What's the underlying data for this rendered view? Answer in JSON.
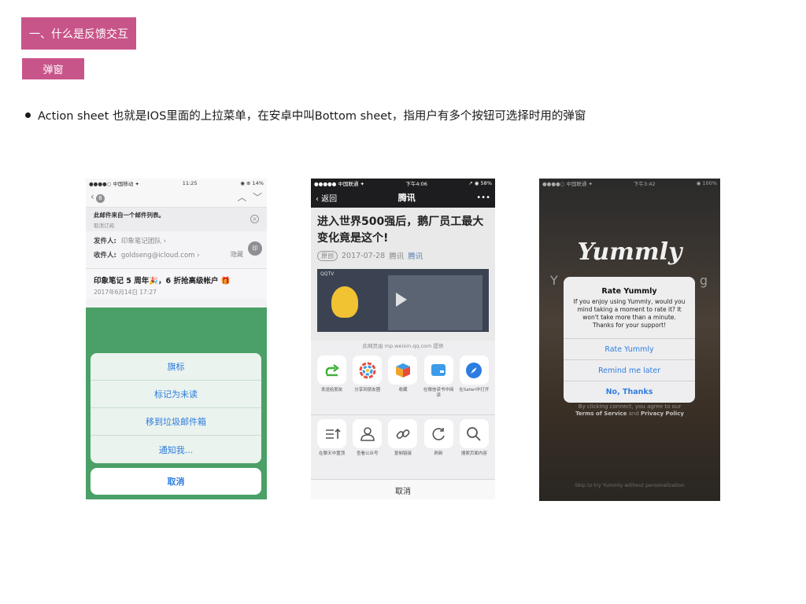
{
  "header": {
    "section_title": "一、什么是反馈交互",
    "subsection": "弹窗"
  },
  "bullet": {
    "text": "Action sheet 也就是IOS里面的上拉菜单，在安卓中叫Bottom sheet，指用户有多个按钮可选择时用的弹窗"
  },
  "colors": {
    "tag_bg": "#c85589",
    "ios_blue": "#2d7ce0"
  },
  "phone1": {
    "status": {
      "carrier": "●●●●○ 中国移动 ✦",
      "time": "11:25",
      "battery": "◉ ⊕ 14%"
    },
    "nav": {
      "back_badge": "8"
    },
    "notice": {
      "line1": "此邮件来自一个邮件列表。",
      "line2": "取消订阅"
    },
    "sender_label": "发件人:",
    "sender_value": "印象笔记团队 ›",
    "recipient_label": "收件人:",
    "recipient_value": "goldseng@icloud.com ›",
    "hide_label": "隐藏",
    "avatar": "印",
    "subject": "印象笔记 5 周年🎉，6 折抢高级帐户 🎁",
    "date": "2017年6月14日 17:27",
    "sheet_options": [
      "旗标",
      "标记为未读",
      "移到垃圾邮件箱",
      "通知我..."
    ],
    "cancel": "取消"
  },
  "phone2": {
    "status": {
      "carrier": "●●●●● 中国联通 ✦",
      "time": "下午4:06",
      "battery": "↗ ◉ 58%"
    },
    "nav": {
      "back": "‹ 返回",
      "title": "腾讯",
      "more": "•••"
    },
    "headline": "进入世界500强后，鹅厂员工最大变化竟是这个!",
    "meta": {
      "original": "原创",
      "date": "2017-07-28",
      "author": "腾讯",
      "account": "腾讯"
    },
    "video_tag": "QQTV",
    "source": "此网页由 mp.weixin.qq.com 提供",
    "row1": [
      {
        "label": "发送给朋友",
        "icon": "share-arrow-icon"
      },
      {
        "label": "分享到朋友圈",
        "icon": "moments-icon"
      },
      {
        "label": "收藏",
        "icon": "favorite-cube-icon"
      },
      {
        "label": "在微信读书中阅读",
        "icon": "wechat-read-icon"
      },
      {
        "label": "在Safari中打开",
        "icon": "safari-compass-icon"
      }
    ],
    "row2": [
      {
        "label": "在聊天中置顶",
        "icon": "pin-top-icon"
      },
      {
        "label": "查看公众号",
        "icon": "profile-icon"
      },
      {
        "label": "复制链接",
        "icon": "link-icon"
      },
      {
        "label": "刷新",
        "icon": "refresh-icon"
      },
      {
        "label": "搜索页面内容",
        "icon": "search-icon"
      }
    ],
    "cancel": "取消"
  },
  "phone3": {
    "status": {
      "carrier": "●●●●○ 中国联通 ✦",
      "time": "下午3:42",
      "battery": "◉ 100%"
    },
    "logo": "Yummly",
    "ghost_left": "Y",
    "ghost_right": "g",
    "alert": {
      "title": "Rate Yummly",
      "message": "If you enjoy using Yummly, would you mind taking a moment to rate it? It won't take more than a minute. Thanks for your support!",
      "buttons": [
        "Rate Yummly",
        "Remind me later",
        "No, Thanks"
      ]
    },
    "terms_prefix": "By clicking connect, you agree to our",
    "terms_link": "Terms of Service",
    "terms_and": "and",
    "privacy_link": "Privacy Policy",
    "skip": "Skip to try Yummly without personalization"
  }
}
